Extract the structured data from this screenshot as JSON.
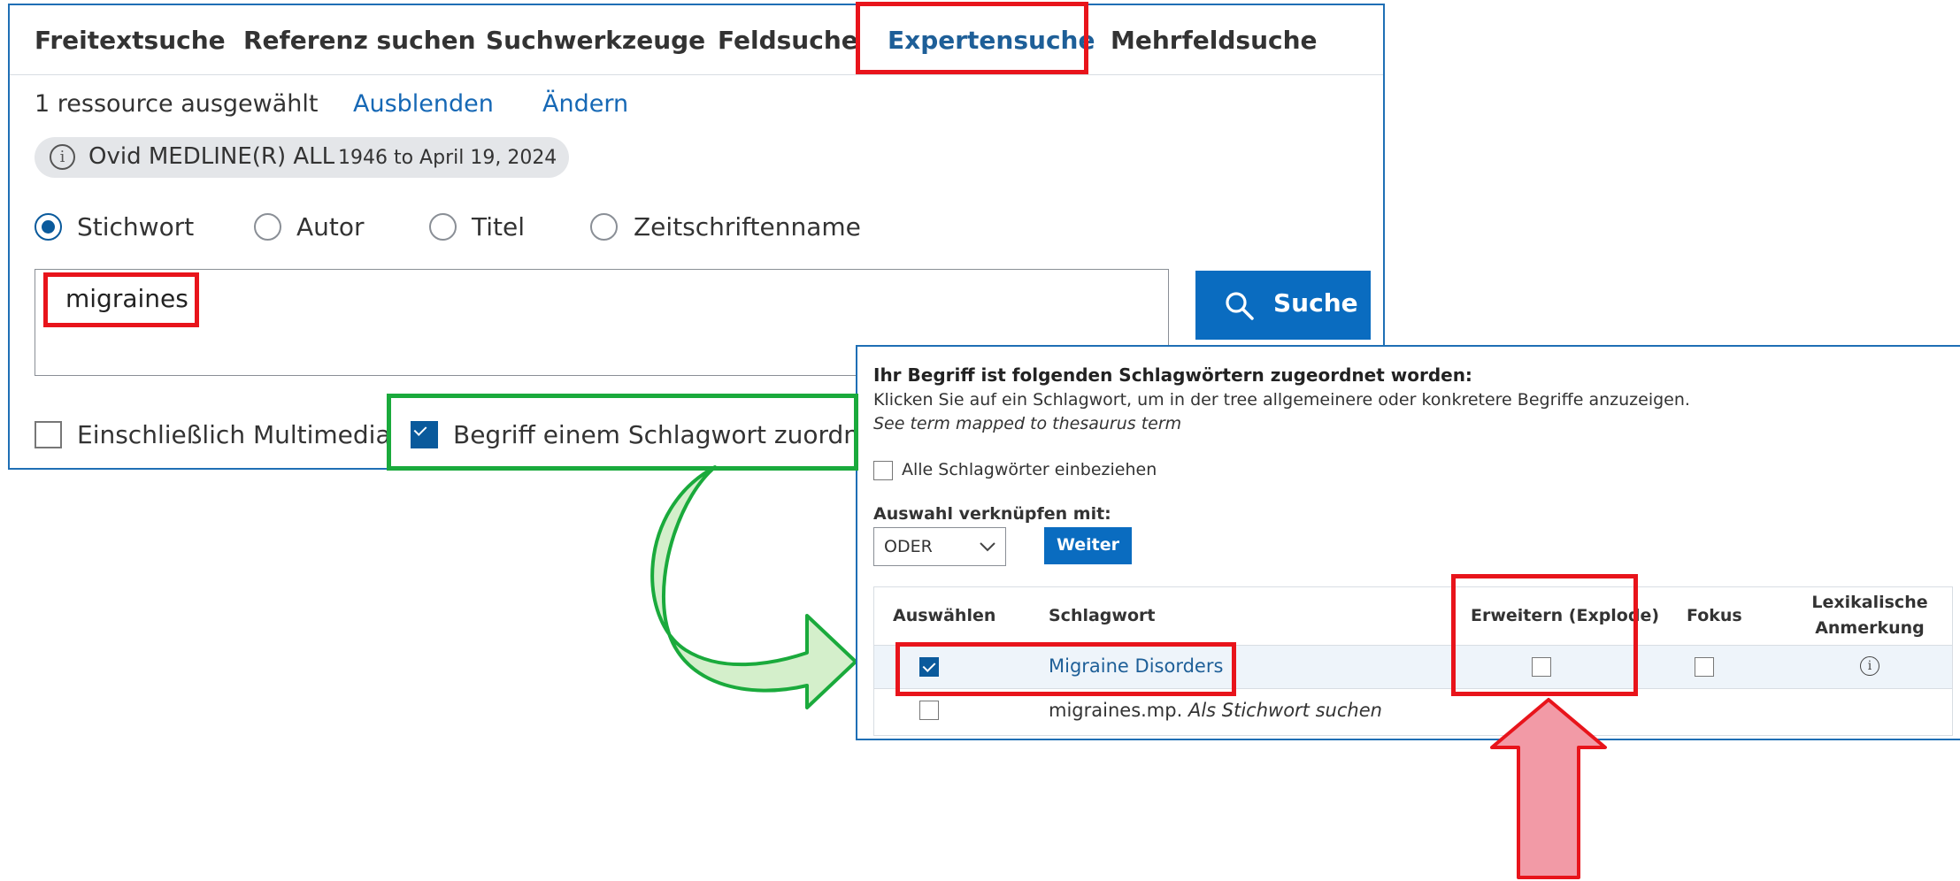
{
  "tabs": [
    {
      "label": "Freitextsuche",
      "active": false
    },
    {
      "label": "Referenz suchen",
      "active": false
    },
    {
      "label": "Suchwerkzeuge",
      "active": false
    },
    {
      "label": "Feldsuche",
      "active": false
    },
    {
      "label": "Expertensuche",
      "active": true
    },
    {
      "label": "Mehrfeldsuche",
      "active": false
    }
  ],
  "resources": {
    "selected_text": "1 ressource ausgewählt",
    "hide_link": "Ausblenden",
    "change_link": "Ändern",
    "database_name": "Ovid MEDLINE(R) ALL",
    "database_range": "1946 to April 19, 2024"
  },
  "search_fields": [
    {
      "label": "Stichwort",
      "selected": true
    },
    {
      "label": "Autor",
      "selected": false
    },
    {
      "label": "Titel",
      "selected": false
    },
    {
      "label": "Zeitschriftenname",
      "selected": false
    }
  ],
  "query": {
    "value": "migraines"
  },
  "search_button": {
    "label": "Suche"
  },
  "options": {
    "multimedia": {
      "label": "Einschließlich Multimedia",
      "checked": false
    },
    "map_term": {
      "label": "Begriff einem Schlagwort zuordnen",
      "checked": true
    }
  },
  "mapping": {
    "heading": "Ihr Begriff ist folgenden Schlagwörtern zugeordnet worden:",
    "instruction": "Klicken Sie auf ein Schlagwort, um in der tree allgemeinere oder konkretere Begriffe anzuzeigen.",
    "see_term": "See term mapped to thesaurus term",
    "include_all": {
      "label": "Alle Schlagwörter einbeziehen",
      "checked": false
    },
    "combine_label": "Auswahl verknüpfen mit:",
    "combine_value": "ODER",
    "continue_button": "Weiter",
    "columns": {
      "select": "Auswählen",
      "subject": "Schlagwort",
      "explode": "Erweitern (Explode)",
      "focus": "Fokus",
      "scope_line1": "Lexikalische",
      "scope_line2": "Anmerkung"
    },
    "rows": [
      {
        "subject": "Migraine Disorders",
        "selected": true,
        "explode": false,
        "focus": false,
        "has_scope_note": true
      },
      {
        "subject": "migraines.mp.",
        "subject_suffix": "Als Stichwort suchen",
        "selected": false
      }
    ]
  },
  "colors": {
    "brand_blue": "#0a5a9c",
    "link_blue": "#1668b5",
    "highlight_red": "#e8141b",
    "highlight_green": "#1aaa3c",
    "arrow_green_fill": "#d4efcb",
    "arrow_red_fill": "#f29aa6"
  }
}
